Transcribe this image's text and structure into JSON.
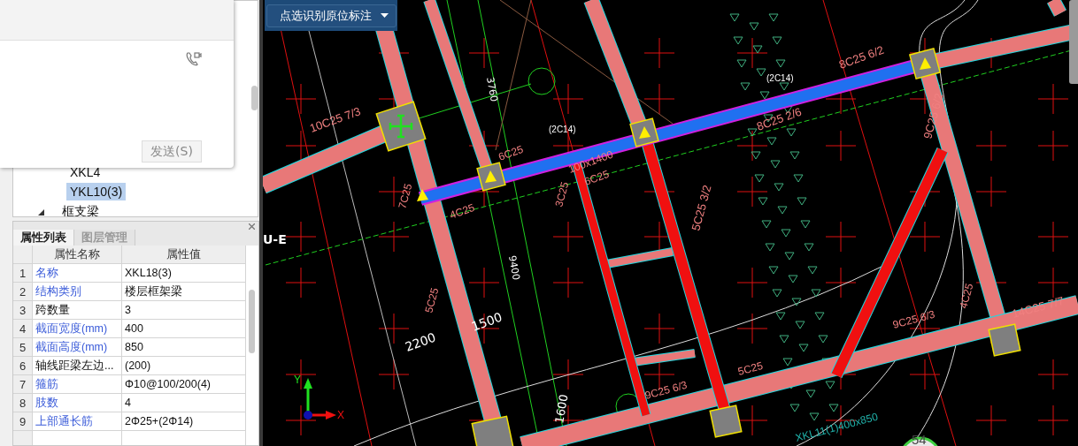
{
  "chat_popup": {
    "send_button": "发送(S)"
  },
  "tree": {
    "items": [
      {
        "label": "XKL4",
        "selected": false
      },
      {
        "label": "YKL10(3)",
        "selected": true
      },
      {
        "label": "框支梁",
        "selected": false
      }
    ]
  },
  "property_panel": {
    "tabs": [
      {
        "label": "属性列表",
        "selected": true
      },
      {
        "label": "图层管理",
        "selected": false
      }
    ],
    "columns": [
      "属性名称",
      "属性值"
    ],
    "rows": [
      {
        "index": "1",
        "name": "名称",
        "value": "XKL18(3)",
        "kind": "public"
      },
      {
        "index": "2",
        "name": "结构类别",
        "value": "楼层框架梁",
        "kind": "public"
      },
      {
        "index": "3",
        "name": "跨数量",
        "value": "3",
        "kind": "private"
      },
      {
        "index": "4",
        "name": "截面宽度(mm)",
        "value": "400",
        "kind": "public"
      },
      {
        "index": "5",
        "name": "截面高度(mm)",
        "value": "850",
        "kind": "public"
      },
      {
        "index": "6",
        "name": "轴线距梁左边...",
        "value": "(200)",
        "kind": "private"
      },
      {
        "index": "7",
        "name": "箍筋",
        "value": "Φ10@100/200(4)",
        "kind": "public"
      },
      {
        "index": "8",
        "name": "肢数",
        "value": "4",
        "kind": "public"
      },
      {
        "index": "9",
        "name": "上部通长筋",
        "value": "2Φ25+(2Φ14)",
        "kind": "public"
      }
    ]
  },
  "canvas": {
    "command_dropdown": {
      "label": "点选识别原位标注"
    },
    "annotations": [
      {
        "text": "10C25 7/3",
        "kind": "rebar",
        "color": "#f08080"
      },
      {
        "text": "7C25",
        "kind": "rebar",
        "color": "#f08080"
      },
      {
        "text": "6C25",
        "kind": "rebar",
        "color": "#f08080"
      },
      {
        "text": "4C25",
        "kind": "rebar",
        "color": "#f08080"
      },
      {
        "text": "3760",
        "kind": "dimension",
        "color": "#ffffff"
      },
      {
        "text": "(2C14)",
        "kind": "rebar",
        "color": "#ffffff"
      },
      {
        "text": "100x1400",
        "kind": "beam",
        "color": "#f08080"
      },
      {
        "text": "6C25",
        "kind": "rebar",
        "color": "#f08080"
      },
      {
        "text": "3C25",
        "kind": "rebar",
        "color": "#f08080"
      },
      {
        "text": "5C25 3/2",
        "kind": "rebar",
        "color": "#f08080"
      },
      {
        "text": "(2C14)",
        "kind": "rebar",
        "color": "#ffffff"
      },
      {
        "text": "8C25 6/2",
        "kind": "rebar",
        "color": "#f08080"
      },
      {
        "text": "8C25 2/6",
        "kind": "rebar",
        "color": "#f08080"
      },
      {
        "text": "9C25 6/2",
        "kind": "rebar",
        "color": "#f08080"
      },
      {
        "text": "U-E",
        "kind": "axis",
        "color": "#ffffff"
      },
      {
        "text": "9400",
        "kind": "dimension",
        "color": "#ffffff"
      },
      {
        "text": "2200",
        "kind": "dimension",
        "color": "#ffffff"
      },
      {
        "text": "1500",
        "kind": "dimension",
        "color": "#ffffff"
      },
      {
        "text": "1600",
        "kind": "dimension",
        "color": "#ffffff"
      },
      {
        "text": "5C25",
        "kind": "rebar",
        "color": "#f08080"
      },
      {
        "text": "9C25 6/3",
        "kind": "rebar",
        "color": "#f08080"
      },
      {
        "text": "5C25",
        "kind": "rebar",
        "color": "#f08080"
      },
      {
        "text": "9C25 6/3",
        "kind": "rebar",
        "color": "#f08080"
      },
      {
        "text": "4C25",
        "kind": "rebar",
        "color": "#f08080"
      },
      {
        "text": "14C25 7/7",
        "kind": "rebar",
        "color": "#f08080"
      },
      {
        "text": "XKL11(1)400x850",
        "kind": "beam",
        "color": "#20b2aa"
      }
    ],
    "axis": {
      "x": "X",
      "y": "Y"
    },
    "zoom_badge": "54"
  }
}
